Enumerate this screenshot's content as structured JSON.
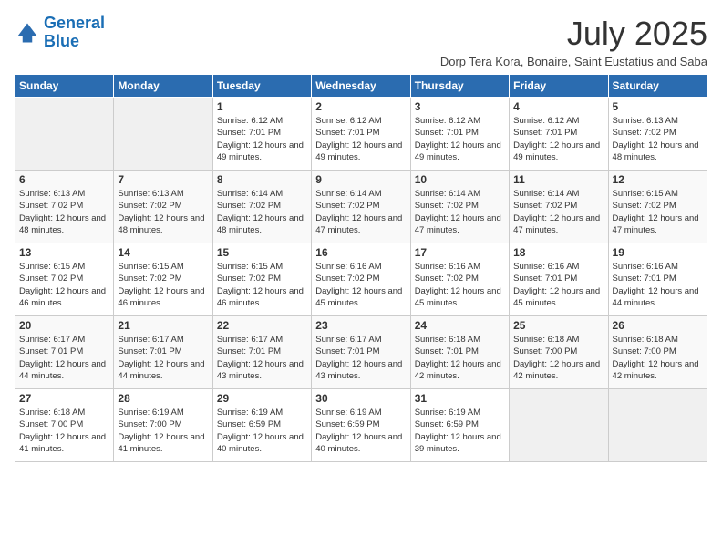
{
  "logo": {
    "line1": "General",
    "line2": "Blue"
  },
  "title": "July 2025",
  "subtitle": "Dorp Tera Kora, Bonaire, Saint Eustatius and Saba",
  "days_header": [
    "Sunday",
    "Monday",
    "Tuesday",
    "Wednesday",
    "Thursday",
    "Friday",
    "Saturday"
  ],
  "weeks": [
    [
      {
        "day": "",
        "sunrise": "",
        "sunset": "",
        "daylight": ""
      },
      {
        "day": "",
        "sunrise": "",
        "sunset": "",
        "daylight": ""
      },
      {
        "day": "1",
        "sunrise": "Sunrise: 6:12 AM",
        "sunset": "Sunset: 7:01 PM",
        "daylight": "Daylight: 12 hours and 49 minutes."
      },
      {
        "day": "2",
        "sunrise": "Sunrise: 6:12 AM",
        "sunset": "Sunset: 7:01 PM",
        "daylight": "Daylight: 12 hours and 49 minutes."
      },
      {
        "day": "3",
        "sunrise": "Sunrise: 6:12 AM",
        "sunset": "Sunset: 7:01 PM",
        "daylight": "Daylight: 12 hours and 49 minutes."
      },
      {
        "day": "4",
        "sunrise": "Sunrise: 6:12 AM",
        "sunset": "Sunset: 7:01 PM",
        "daylight": "Daylight: 12 hours and 49 minutes."
      },
      {
        "day": "5",
        "sunrise": "Sunrise: 6:13 AM",
        "sunset": "Sunset: 7:02 PM",
        "daylight": "Daylight: 12 hours and 48 minutes."
      }
    ],
    [
      {
        "day": "6",
        "sunrise": "Sunrise: 6:13 AM",
        "sunset": "Sunset: 7:02 PM",
        "daylight": "Daylight: 12 hours and 48 minutes."
      },
      {
        "day": "7",
        "sunrise": "Sunrise: 6:13 AM",
        "sunset": "Sunset: 7:02 PM",
        "daylight": "Daylight: 12 hours and 48 minutes."
      },
      {
        "day": "8",
        "sunrise": "Sunrise: 6:14 AM",
        "sunset": "Sunset: 7:02 PM",
        "daylight": "Daylight: 12 hours and 48 minutes."
      },
      {
        "day": "9",
        "sunrise": "Sunrise: 6:14 AM",
        "sunset": "Sunset: 7:02 PM",
        "daylight": "Daylight: 12 hours and 47 minutes."
      },
      {
        "day": "10",
        "sunrise": "Sunrise: 6:14 AM",
        "sunset": "Sunset: 7:02 PM",
        "daylight": "Daylight: 12 hours and 47 minutes."
      },
      {
        "day": "11",
        "sunrise": "Sunrise: 6:14 AM",
        "sunset": "Sunset: 7:02 PM",
        "daylight": "Daylight: 12 hours and 47 minutes."
      },
      {
        "day": "12",
        "sunrise": "Sunrise: 6:15 AM",
        "sunset": "Sunset: 7:02 PM",
        "daylight": "Daylight: 12 hours and 47 minutes."
      }
    ],
    [
      {
        "day": "13",
        "sunrise": "Sunrise: 6:15 AM",
        "sunset": "Sunset: 7:02 PM",
        "daylight": "Daylight: 12 hours and 46 minutes."
      },
      {
        "day": "14",
        "sunrise": "Sunrise: 6:15 AM",
        "sunset": "Sunset: 7:02 PM",
        "daylight": "Daylight: 12 hours and 46 minutes."
      },
      {
        "day": "15",
        "sunrise": "Sunrise: 6:15 AM",
        "sunset": "Sunset: 7:02 PM",
        "daylight": "Daylight: 12 hours and 46 minutes."
      },
      {
        "day": "16",
        "sunrise": "Sunrise: 6:16 AM",
        "sunset": "Sunset: 7:02 PM",
        "daylight": "Daylight: 12 hours and 45 minutes."
      },
      {
        "day": "17",
        "sunrise": "Sunrise: 6:16 AM",
        "sunset": "Sunset: 7:02 PM",
        "daylight": "Daylight: 12 hours and 45 minutes."
      },
      {
        "day": "18",
        "sunrise": "Sunrise: 6:16 AM",
        "sunset": "Sunset: 7:01 PM",
        "daylight": "Daylight: 12 hours and 45 minutes."
      },
      {
        "day": "19",
        "sunrise": "Sunrise: 6:16 AM",
        "sunset": "Sunset: 7:01 PM",
        "daylight": "Daylight: 12 hours and 44 minutes."
      }
    ],
    [
      {
        "day": "20",
        "sunrise": "Sunrise: 6:17 AM",
        "sunset": "Sunset: 7:01 PM",
        "daylight": "Daylight: 12 hours and 44 minutes."
      },
      {
        "day": "21",
        "sunrise": "Sunrise: 6:17 AM",
        "sunset": "Sunset: 7:01 PM",
        "daylight": "Daylight: 12 hours and 44 minutes."
      },
      {
        "day": "22",
        "sunrise": "Sunrise: 6:17 AM",
        "sunset": "Sunset: 7:01 PM",
        "daylight": "Daylight: 12 hours and 43 minutes."
      },
      {
        "day": "23",
        "sunrise": "Sunrise: 6:17 AM",
        "sunset": "Sunset: 7:01 PM",
        "daylight": "Daylight: 12 hours and 43 minutes."
      },
      {
        "day": "24",
        "sunrise": "Sunrise: 6:18 AM",
        "sunset": "Sunset: 7:01 PM",
        "daylight": "Daylight: 12 hours and 42 minutes."
      },
      {
        "day": "25",
        "sunrise": "Sunrise: 6:18 AM",
        "sunset": "Sunset: 7:00 PM",
        "daylight": "Daylight: 12 hours and 42 minutes."
      },
      {
        "day": "26",
        "sunrise": "Sunrise: 6:18 AM",
        "sunset": "Sunset: 7:00 PM",
        "daylight": "Daylight: 12 hours and 42 minutes."
      }
    ],
    [
      {
        "day": "27",
        "sunrise": "Sunrise: 6:18 AM",
        "sunset": "Sunset: 7:00 PM",
        "daylight": "Daylight: 12 hours and 41 minutes."
      },
      {
        "day": "28",
        "sunrise": "Sunrise: 6:19 AM",
        "sunset": "Sunset: 7:00 PM",
        "daylight": "Daylight: 12 hours and 41 minutes."
      },
      {
        "day": "29",
        "sunrise": "Sunrise: 6:19 AM",
        "sunset": "Sunset: 6:59 PM",
        "daylight": "Daylight: 12 hours and 40 minutes."
      },
      {
        "day": "30",
        "sunrise": "Sunrise: 6:19 AM",
        "sunset": "Sunset: 6:59 PM",
        "daylight": "Daylight: 12 hours and 40 minutes."
      },
      {
        "day": "31",
        "sunrise": "Sunrise: 6:19 AM",
        "sunset": "Sunset: 6:59 PM",
        "daylight": "Daylight: 12 hours and 39 minutes."
      },
      {
        "day": "",
        "sunrise": "",
        "sunset": "",
        "daylight": ""
      },
      {
        "day": "",
        "sunrise": "",
        "sunset": "",
        "daylight": ""
      }
    ]
  ]
}
